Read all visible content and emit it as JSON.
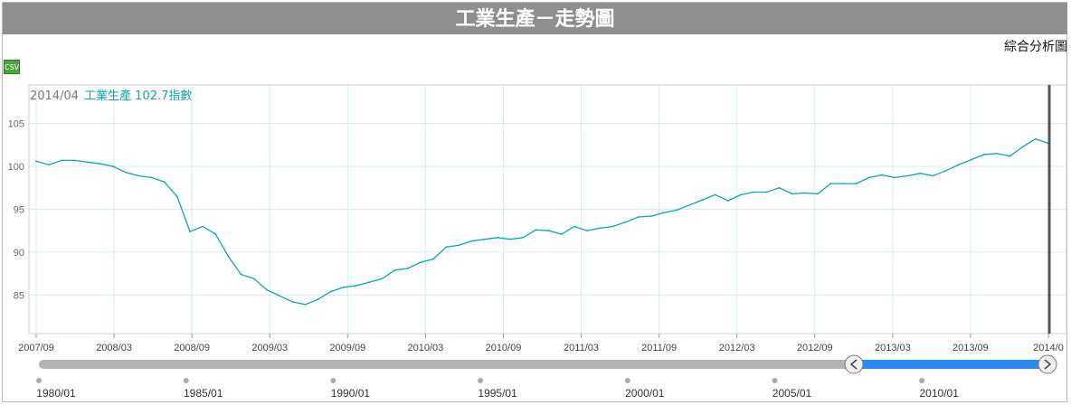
{
  "page": {
    "title": "工業生產－走勢圖",
    "analysis_link": "綜合分析圖",
    "csv_label": "CSV"
  },
  "hover": {
    "date": "2014/04",
    "series": "工業生產",
    "value": "102.7",
    "unit": "指數"
  },
  "colors": {
    "line": "#12a6a6",
    "grid": "#d6ecf2",
    "scroll_selected": "#2d88f0",
    "scroll_track": "#b3b3b3"
  },
  "navigator": {
    "labels": [
      "1980/01",
      "1985/01",
      "1990/01",
      "1995/01",
      "2000/01",
      "2005/01",
      "2010/01"
    ],
    "selected_from": "2007/09",
    "selected_to": "2014/04"
  },
  "chart_data": {
    "type": "line",
    "xlabel": "",
    "ylabel": "",
    "x_ticks": [
      "2007/09",
      "2008/03",
      "2008/09",
      "2009/03",
      "2009/09",
      "2010/03",
      "2010/09",
      "2011/03",
      "2011/09",
      "2012/03",
      "2012/09",
      "2013/03",
      "2013/09",
      "2014/0"
    ],
    "y_ticks": [
      85,
      90,
      95,
      100,
      105
    ],
    "grid": true,
    "series": [
      {
        "x": [
          "2007/09",
          "2007/10",
          "2007/11",
          "2007/12",
          "2008/01",
          "2008/02",
          "2008/03",
          "2008/04",
          "2008/05",
          "2008/06",
          "2008/07",
          "2008/08",
          "2008/09",
          "2008/10",
          "2008/11",
          "2008/12",
          "2009/01",
          "2009/02",
          "2009/03",
          "2009/04",
          "2009/05",
          "2009/06",
          "2009/07",
          "2009/08",
          "2009/09",
          "2009/10",
          "2009/11",
          "2009/12",
          "2010/01",
          "2010/02",
          "2010/03",
          "2010/04",
          "2010/05",
          "2010/06",
          "2010/07",
          "2010/08",
          "2010/09",
          "2010/10",
          "2010/11",
          "2010/12",
          "2011/01",
          "2011/02",
          "2011/03",
          "2011/04",
          "2011/05",
          "2011/06",
          "2011/07",
          "2011/08",
          "2011/09",
          "2011/10",
          "2011/11",
          "2011/12",
          "2012/01",
          "2012/02",
          "2012/03",
          "2012/04",
          "2012/05",
          "2012/06",
          "2012/07",
          "2012/08",
          "2012/09",
          "2012/10",
          "2012/11",
          "2012/12",
          "2013/01",
          "2013/02",
          "2013/03",
          "2013/04",
          "2013/05",
          "2013/06",
          "2013/07",
          "2013/08",
          "2013/09",
          "2013/10",
          "2013/11",
          "2013/12",
          "2014/01",
          "2014/02",
          "2014/03",
          "2014/04"
        ],
        "values": [
          100.6,
          100.2,
          100.7,
          100.7,
          100.5,
          100.3,
          100.0,
          99.3,
          98.9,
          98.7,
          98.2,
          96.5,
          92.4,
          93.0,
          92.1,
          89.5,
          87.4,
          86.9,
          85.6,
          84.9,
          84.2,
          83.9,
          84.5,
          85.4,
          85.9,
          86.1,
          86.5,
          86.9,
          87.9,
          88.1,
          88.8,
          89.2,
          90.6,
          90.8,
          91.3,
          91.5,
          91.7,
          91.5,
          91.7,
          92.6,
          92.5,
          92.1,
          93.0,
          92.5,
          92.8,
          93.0,
          93.5,
          94.1,
          94.2,
          94.6,
          94.9,
          95.5,
          96.1,
          96.7,
          96.0,
          96.7,
          97.0,
          97.0,
          97.5,
          96.8,
          96.9,
          96.8,
          98.0,
          98.0,
          98.0,
          98.7,
          99.0,
          98.7,
          98.9,
          99.2,
          98.9,
          99.5,
          100.2,
          100.8,
          101.4,
          101.5,
          101.2,
          102.3,
          103.2,
          102.7
        ]
      }
    ],
    "ylim": [
      80.5,
      109.5
    ]
  }
}
